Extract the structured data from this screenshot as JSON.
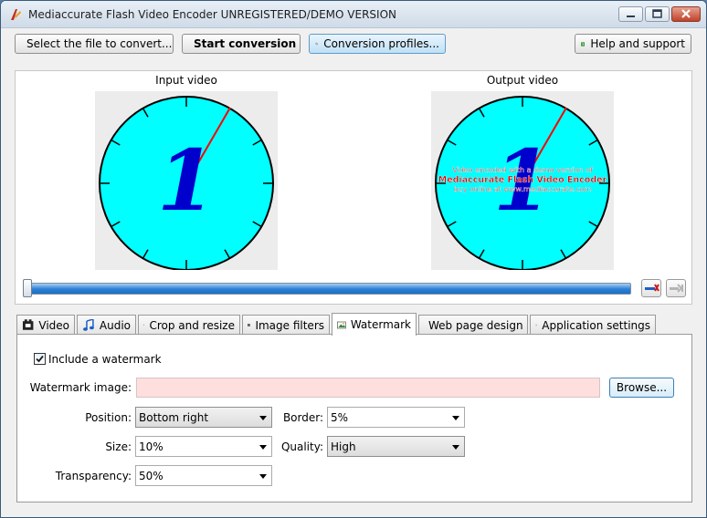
{
  "window": {
    "title": "Mediaccurate Flash Video Encoder UNREGISTERED/DEMO VERSION"
  },
  "toolbar": {
    "select_file": "Select the file to convert...",
    "start_conversion": "Start conversion",
    "conversion_profiles": "Conversion profiles...",
    "help_support": "Help and support"
  },
  "preview": {
    "input_label": "Input video",
    "output_label": "Output video",
    "clock_digit": "1",
    "demo_watermark": [
      "Video encoded with a demo version of",
      "Mediaccurate Flash Video Encoder",
      "buy online at www.mediaccurate.com"
    ]
  },
  "tabs": [
    {
      "label": "Video",
      "icon": "film-icon"
    },
    {
      "label": "Audio",
      "icon": "music-note-icon"
    },
    {
      "label": "Crop and resize",
      "icon": "crop-icon"
    },
    {
      "label": "Image filters",
      "icon": "color-bars-icon"
    },
    {
      "label": "Watermark",
      "icon": "picture-icon"
    },
    {
      "label": "Web page design",
      "icon": "palette-icon"
    },
    {
      "label": "Application settings",
      "icon": "gear-icon"
    }
  ],
  "watermark": {
    "include_label": "Include a watermark",
    "include_checked": true,
    "image_label": "Watermark image:",
    "image_value": "",
    "browse_label": "Browse...",
    "position_label": "Position:",
    "position_value": "Bottom right",
    "border_label": "Border:",
    "border_value": "5%",
    "size_label": "Size:",
    "size_value": "10%",
    "quality_label": "Quality:",
    "quality_value": "High",
    "transparency_label": "Transparency:",
    "transparency_value": "50%"
  },
  "colors": {
    "clock_face": "#00ffff",
    "clock_hand": "#0000cc",
    "second_hand": "#ff0000",
    "watermark_input_bg": "#ffdede",
    "progress_blue": "#2a7fd6"
  }
}
